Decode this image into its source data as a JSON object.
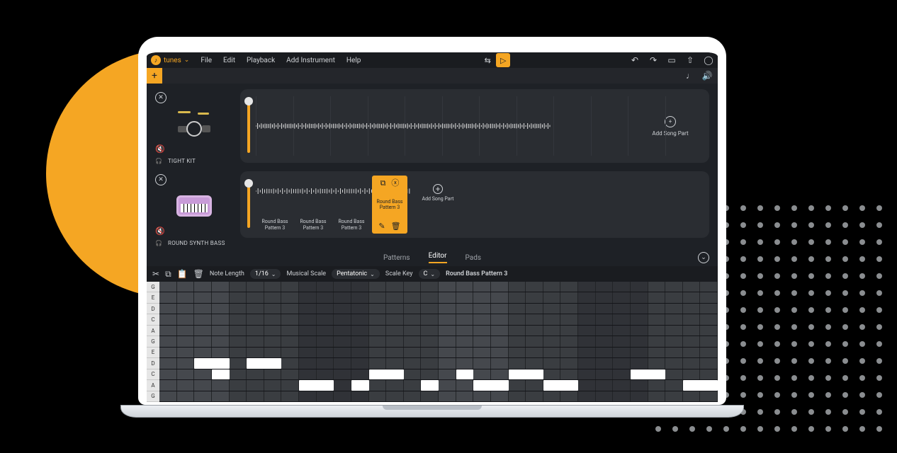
{
  "brand": "tunes",
  "menu": {
    "file": "File",
    "edit": "Edit",
    "playback": "Playback",
    "addinst": "Add Instrument",
    "help": "Help"
  },
  "tracks": [
    {
      "name": "TIGHT KIT",
      "add": "Add Song Part"
    },
    {
      "name": "ROUND SYNTH BASS",
      "patterns": [
        "Round Bass Pattern 3",
        "Round Bass Pattern 3",
        "Round Bass Pattern 3",
        "Round Bass Pattern 3"
      ],
      "add": "Add Song Part"
    }
  ],
  "tabs": {
    "patterns": "Patterns",
    "editor": "Editor",
    "pads": "Pads"
  },
  "editor": {
    "notelen_label": "Note Length",
    "notelen_val": "1/16",
    "scale_label": "Musical Scale",
    "scale_val": "Pentatonic",
    "key_label": "Scale Key",
    "key_val": "C",
    "pattern_name": "Round Bass Pattern 3"
  },
  "note_rows": [
    "G",
    "E",
    "D",
    "C",
    "A",
    "G",
    "E",
    "D",
    "C",
    "A",
    "G"
  ],
  "note_cols": 32,
  "notes": [
    {
      "row": 7,
      "start": 2,
      "len": 2
    },
    {
      "row": 7,
      "start": 5,
      "len": 2
    },
    {
      "row": 8,
      "start": 3,
      "len": 1
    },
    {
      "row": 9,
      "start": 8,
      "len": 2
    },
    {
      "row": 9,
      "start": 11,
      "len": 1
    },
    {
      "row": 8,
      "start": 12,
      "len": 2
    },
    {
      "row": 9,
      "start": 15,
      "len": 1
    },
    {
      "row": 8,
      "start": 17,
      "len": 1
    },
    {
      "row": 9,
      "start": 18,
      "len": 2
    },
    {
      "row": 8,
      "start": 20,
      "len": 2
    },
    {
      "row": 9,
      "start": 22,
      "len": 2
    },
    {
      "row": 8,
      "start": 27,
      "len": 2
    },
    {
      "row": 9,
      "start": 30,
      "len": 2
    }
  ]
}
